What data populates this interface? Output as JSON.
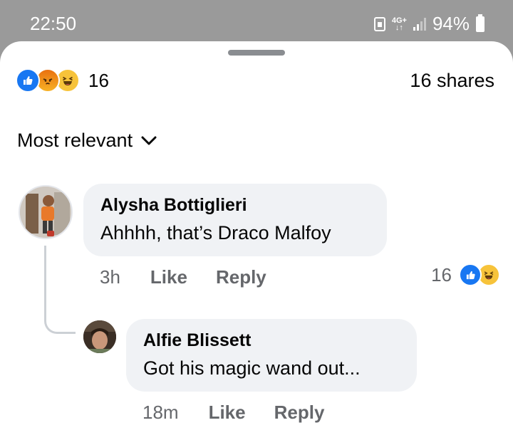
{
  "status_bar": {
    "time": "22:50",
    "network": "4G+",
    "battery": "94%"
  },
  "post": {
    "reaction_count": "16",
    "reaction_types": [
      "like",
      "angry",
      "haha"
    ],
    "shares": "16 shares"
  },
  "sort": {
    "label": "Most relevant"
  },
  "comments": [
    {
      "author": "Alysha Bottiglieri",
      "text": "Ahhhh, that’s Draco Malfoy",
      "time": "3h",
      "like_label": "Like",
      "reply_label": "Reply",
      "reaction_count": "16",
      "reaction_types": [
        "like",
        "haha"
      ]
    },
    {
      "author": "Alfie Blissett",
      "text": "Got his magic wand out...",
      "time": "18m",
      "like_label": "Like",
      "reply_label": "Reply"
    }
  ],
  "colors": {
    "like_blue": "#1877f2",
    "bubble_bg": "#f0f2f5",
    "meta_gray": "#65676b"
  }
}
